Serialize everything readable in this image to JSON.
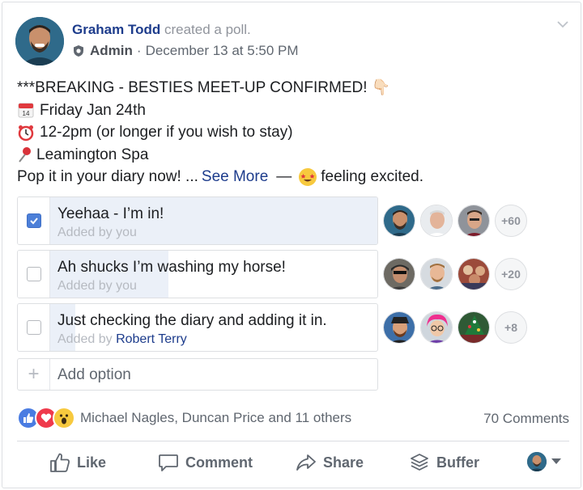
{
  "post": {
    "author": "Graham Todd",
    "action": "created a poll.",
    "role": "Admin",
    "separator": "·",
    "timestamp": "December 13 at 5:50 PM",
    "lines": [
      {
        "emoji": "",
        "text": "***BREAKING - BESTIES MEET-UP CONFIRMED! 👇🏻"
      },
      {
        "emoji": "calendar",
        "text": "Friday Jan 24th"
      },
      {
        "emoji": "alarm-clock",
        "text": "12-2pm (or longer if you wish to stay)"
      },
      {
        "emoji": "pushpin",
        "text": "Leamington Spa"
      }
    ],
    "last_line": "Pop it in your diary now! ...",
    "see_more": "See More",
    "dash": "—",
    "feeling": "feeling excited."
  },
  "poll": {
    "options": [
      {
        "text": "Yeehaa - I’m in!",
        "added_prefix": "Added by ",
        "added_by": "you",
        "checked": true,
        "fill_fraction": 1.0,
        "more": "+60"
      },
      {
        "text": "Ah shucks I’m washing my horse!",
        "added_prefix": "Added by ",
        "added_by": "you",
        "checked": false,
        "fill_fraction": 0.42,
        "more": "+20"
      },
      {
        "text": "Just checking the diary and adding it in.",
        "added_prefix": "Added by ",
        "added_by": "Robert Terry",
        "checked": false,
        "fill_fraction": 0.16,
        "more": "+8"
      }
    ],
    "add_option_placeholder": "Add option",
    "add_option_icon": "plus-icon"
  },
  "reactions": {
    "icons": [
      "like",
      "love",
      "wow"
    ],
    "names": "Michael Nagles, Duncan Price and 11 others",
    "comments": "70 Comments"
  },
  "actions": {
    "like": "Like",
    "comment": "Comment",
    "share": "Share",
    "buffer": "Buffer"
  },
  "colors": {
    "link": "#1d3c8c",
    "checkbox": "#4c7fd8",
    "poll_fill": "#ebf0f8",
    "like": "#4a7ce2",
    "love": "#ef3a4c",
    "wow": "#f7c93e"
  }
}
